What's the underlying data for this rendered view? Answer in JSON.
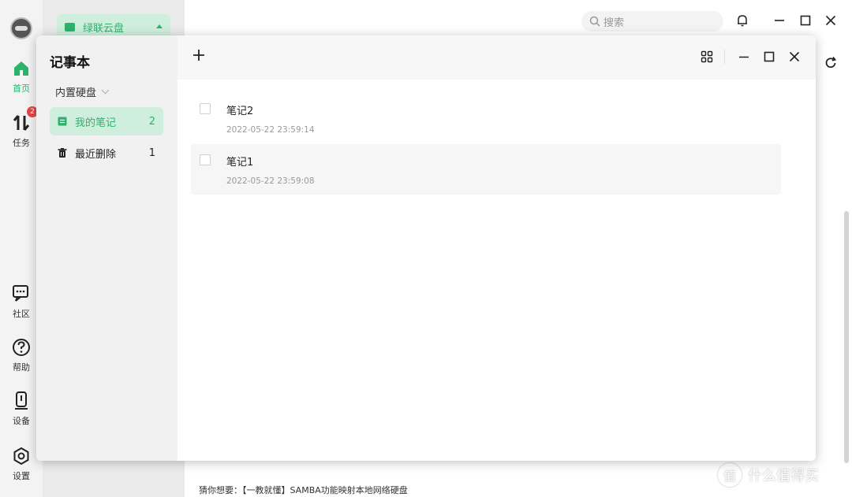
{
  "background_app": {
    "rail": [
      {
        "label": "首页",
        "icon": "home-icon",
        "active": true
      },
      {
        "label": "任务",
        "icon": "transfer-icon",
        "badge": "2"
      },
      {
        "label": "社区",
        "icon": "chat-icon"
      },
      {
        "label": "帮助",
        "icon": "help-icon"
      },
      {
        "label": "设备",
        "icon": "device-icon"
      },
      {
        "label": "设置",
        "icon": "settings-icon"
      }
    ],
    "cloud_selector": "绿联云盘",
    "search_placeholder": "搜索",
    "bottom_tip": "猜你想要：【一教就懂】SAMBA功能映射本地网络硬盘",
    "watermark": "什么值得买",
    "watermark_icon_glyph": "值"
  },
  "notepad": {
    "title": "记事本",
    "disk": "内置硬盘",
    "sidebar": [
      {
        "label": "我的笔记",
        "count": "2",
        "icon": "note-icon",
        "active": true
      },
      {
        "label": "最近删除",
        "count": "1",
        "icon": "trash-icon"
      }
    ],
    "notes": [
      {
        "name": "笔记2",
        "time": "2022-05-22 23:59:14"
      },
      {
        "name": "笔记1",
        "time": "2022-05-22 23:59:08"
      }
    ]
  },
  "colors": {
    "accent": "#2bb36a",
    "accent_light": "#cfeedd",
    "badge": "#e54545"
  }
}
